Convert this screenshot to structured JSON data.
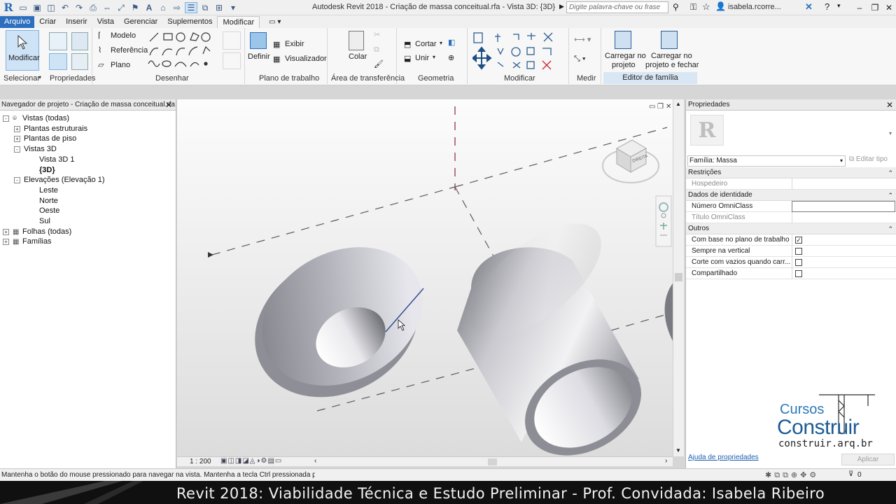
{
  "window": {
    "title": "Autodesk Revit 2018 -   Criação de massa conceitual.rfa - Vista 3D: {3D}",
    "search_placeholder": "Digite palavra-chave ou frase",
    "user": "isabela.rcorre..."
  },
  "ribbon": {
    "tabs": [
      "Arquivo",
      "Criar",
      "Inserir",
      "Vista",
      "Gerenciar",
      "Suplementos",
      "Modificar"
    ],
    "active_tab": "Modificar",
    "buttons": {
      "modificar": "Modificar",
      "modelo": "Modelo",
      "referencia": "Referência",
      "plano": "Plano",
      "definir": "Definir",
      "exibir": "Exibir",
      "visualizador": "Visualizador",
      "colar": "Colar",
      "cortar": "Cortar",
      "unir": "Unir",
      "carregar_projeto": "Carregar no",
      "carregar_projeto_2": "projeto",
      "carregar_fechar": "Carregar no",
      "carregar_fechar_2": "projeto e fechar"
    },
    "panels": [
      "Selecionar",
      "Propriedades",
      "Desenhar",
      "Plano de trabalho",
      "Área de transferência",
      "Geometria",
      "Modificar",
      "Medir",
      "Editor de família"
    ]
  },
  "project_browser": {
    "title": "Navegador de projeto - Criação de massa conceitual.rfa",
    "items": [
      {
        "label": "Vistas (todas)",
        "level": 0,
        "expander": "-"
      },
      {
        "label": "Plantas estruturais",
        "level": 1,
        "expander": "+"
      },
      {
        "label": "Plantas de piso",
        "level": 1,
        "expander": "+"
      },
      {
        "label": "Vistas 3D",
        "level": 1,
        "expander": "-"
      },
      {
        "label": "Vista 3D 1",
        "level": 2,
        "expander": ""
      },
      {
        "label": "{3D}",
        "level": 2,
        "expander": "",
        "selected": true
      },
      {
        "label": "Elevações (Elevação 1)",
        "level": 1,
        "expander": "-"
      },
      {
        "label": "Leste",
        "level": 2,
        "expander": ""
      },
      {
        "label": "Norte",
        "level": 2,
        "expander": ""
      },
      {
        "label": "Oeste",
        "level": 2,
        "expander": ""
      },
      {
        "label": "Sul",
        "level": 2,
        "expander": ""
      },
      {
        "label": "Folhas (todas)",
        "level": 0,
        "expander": "+"
      },
      {
        "label": "Famílias",
        "level": 0,
        "expander": "+"
      }
    ]
  },
  "viewport": {
    "scale": "1 : 200",
    "viewcube_label": "DIREITA"
  },
  "properties": {
    "title": "Propriedades",
    "family": "Família: Massa",
    "edit_type": "Editar tipo",
    "categories": [
      {
        "name": "Restrições",
        "rows": [
          {
            "label": "Hospedeiro",
            "type": "text",
            "value": "",
            "greyed": true
          }
        ]
      },
      {
        "name": "Dados de identidade",
        "rows": [
          {
            "label": "Número OmniClass",
            "type": "field",
            "value": ""
          },
          {
            "label": "Título OmniClass",
            "type": "text",
            "value": "",
            "greyed": true
          }
        ]
      },
      {
        "name": "Outros",
        "rows": [
          {
            "label": "Com base no plano de trabalho",
            "type": "checkbox",
            "checked": true
          },
          {
            "label": "Sempre na vertical",
            "type": "checkbox",
            "checked": false
          },
          {
            "label": "Corte com vazios quando carr...",
            "type": "checkbox",
            "checked": false
          },
          {
            "label": "Compartilhado",
            "type": "checkbox",
            "checked": false
          }
        ]
      }
    ],
    "help_link": "Ajuda de propriedades",
    "apply": "Aplicar"
  },
  "status": {
    "message": "Mantenha o botão do mouse pressionado para navegar na vista. Mantenha a tecla Ctrl pressionada pa",
    "filter_count": "0"
  },
  "footer": {
    "course_title": "Revit 2018: Viabilidade Técnica e Estudo Preliminar - Prof. Convidada: Isabela Ribeiro",
    "watermark_line1": "Cursos",
    "watermark_line2": "Construir",
    "watermark_url": "construir.arq.br"
  },
  "colors": {
    "accent": "#2c6fbf",
    "tab_active_bg": "#f7f7f7",
    "editor_panel_bg": "#d9e6f4",
    "footer_bg": "#101010"
  }
}
